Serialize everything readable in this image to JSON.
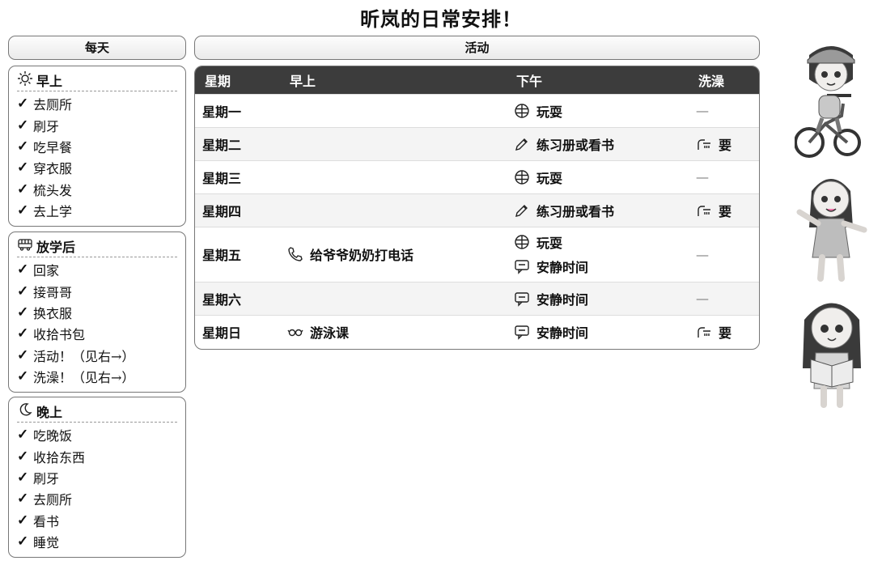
{
  "title": "昕岚的日常安排！",
  "headers": {
    "daily": "每天",
    "activities": "活动"
  },
  "sections": {
    "morning": {
      "title": "早上",
      "icon": "sun-icon",
      "items": [
        "去厕所",
        "刷牙",
        "吃早餐",
        "穿衣服",
        "梳头发",
        "去上学"
      ]
    },
    "after_school": {
      "title": "放学后",
      "icon": "bus-icon",
      "items": [
        "回家",
        "接哥哥",
        "换衣服",
        "收拾书包",
        "活动！（见右→）",
        "洗澡！（见右→）"
      ]
    },
    "evening": {
      "title": "晚上",
      "icon": "moon-icon",
      "items": [
        "吃晚饭",
        "收拾东西",
        "刷牙",
        "去厕所",
        "看书",
        "睡觉"
      ]
    }
  },
  "check_mark": "✓",
  "table": {
    "columns": [
      "星期",
      "早上",
      "下午",
      "洗澡"
    ],
    "rows": [
      {
        "day": "星期一",
        "morning": "",
        "afternoon": [
          {
            "icon": "ball-icon",
            "text": "玩耍"
          }
        ],
        "bath": "—"
      },
      {
        "day": "星期二",
        "morning": "",
        "afternoon": [
          {
            "icon": "pencil-icon",
            "text": "练习册或看书"
          }
        ],
        "bath": "要"
      },
      {
        "day": "星期三",
        "morning": "",
        "afternoon": [
          {
            "icon": "ball-icon",
            "text": "玩耍"
          }
        ],
        "bath": "—"
      },
      {
        "day": "星期四",
        "morning": "",
        "afternoon": [
          {
            "icon": "pencil-icon",
            "text": "练习册或看书"
          }
        ],
        "bath": "要"
      },
      {
        "day": "星期五",
        "morning": {
          "icon": "phone-icon",
          "text": "给爷爷奶奶打电话"
        },
        "afternoon": [
          {
            "icon": "ball-icon",
            "text": "玩耍"
          },
          {
            "icon": "chat-icon",
            "text": "安静时间"
          }
        ],
        "bath": "—"
      },
      {
        "day": "星期六",
        "morning": "",
        "afternoon": [
          {
            "icon": "chat-icon",
            "text": "安静时间"
          }
        ],
        "bath": "—"
      },
      {
        "day": "星期日",
        "morning": {
          "icon": "goggles-icon",
          "text": "游泳课"
        },
        "afternoon": [
          {
            "icon": "chat-icon",
            "text": "安静时间"
          }
        ],
        "bath": "要"
      }
    ]
  },
  "illustrations": [
    "girl-on-bike-illustration",
    "girl-waving-illustration",
    "girl-reading-illustration"
  ]
}
